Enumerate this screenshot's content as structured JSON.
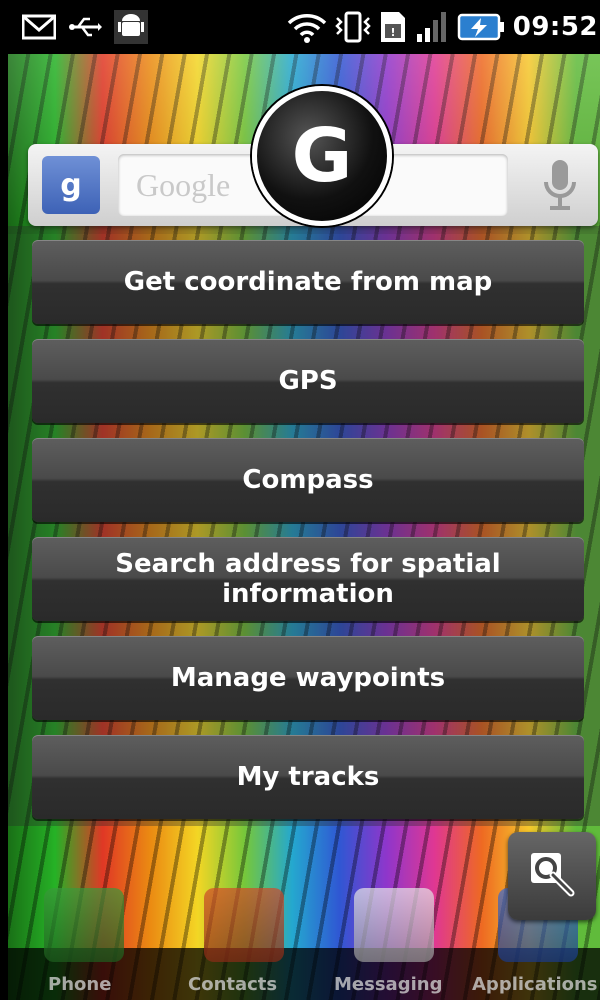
{
  "status_bar": {
    "time": "09:52",
    "icons": [
      "gmail-icon",
      "usb-icon",
      "android-debug-icon",
      "wifi-icon",
      "vibrate-icon",
      "sim-icon",
      "signal-icon",
      "battery-charging-icon"
    ]
  },
  "home_widget": {
    "search_placeholder": "Google",
    "google_badge": "g"
  },
  "app": {
    "logo_letter": "G"
  },
  "menu": {
    "items": [
      {
        "label": "Get coordinate from map"
      },
      {
        "label": "GPS"
      },
      {
        "label": "Compass"
      },
      {
        "label": "Search address for spatial information"
      },
      {
        "label": "Manage waypoints"
      },
      {
        "label": "My tracks"
      }
    ]
  },
  "dock": {
    "items": [
      {
        "label": "Phone"
      },
      {
        "label": "Contacts"
      },
      {
        "label": "Messaging"
      },
      {
        "label": "Applications"
      }
    ]
  },
  "colors": {
    "button_top": "#5e5e5e",
    "button_bottom": "#2a2a2a",
    "text": "#ffffff"
  }
}
